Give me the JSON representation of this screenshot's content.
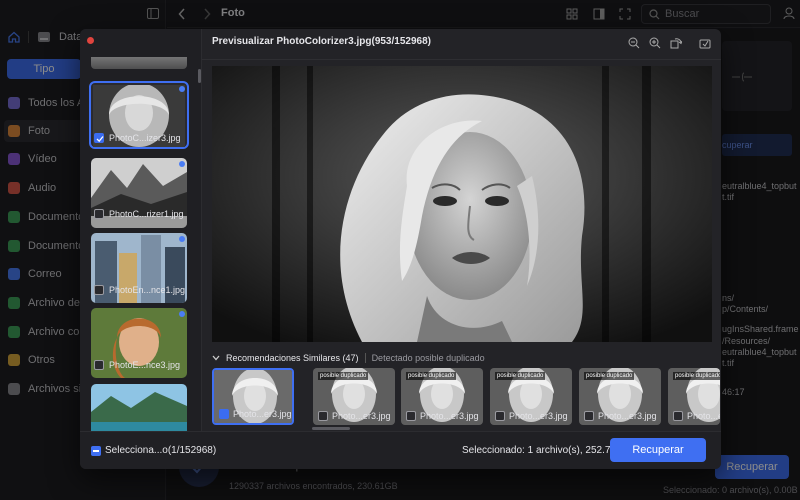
{
  "sidebar": {
    "root_label": "Data",
    "tipo_button": "Tipo",
    "items": [
      {
        "label": "Todos los Arc",
        "icon": "all-files-icon",
        "color": "#7a6fd8"
      },
      {
        "label": "Foto",
        "icon": "photo-icon",
        "color": "#e08a3c"
      },
      {
        "label": "Vídeo",
        "icon": "video-icon",
        "color": "#8a5ad8"
      },
      {
        "label": "Audio",
        "icon": "audio-icon",
        "color": "#d8584a"
      },
      {
        "label": "Documento",
        "icon": "document-icon",
        "color": "#3fa05a"
      },
      {
        "label": "Documentos",
        "icon": "documents-icon",
        "color": "#3fa05a"
      },
      {
        "label": "Correo",
        "icon": "mail-icon",
        "color": "#4a7df5"
      },
      {
        "label": "Archivo de la",
        "icon": "archive-icon",
        "color": "#3fa05a"
      },
      {
        "label": "Archivo comp",
        "icon": "compressed-icon",
        "color": "#3fa05a"
      },
      {
        "label": "Otros",
        "icon": "other-icon",
        "color": "#d8a83c"
      },
      {
        "label": "Archivos sin s",
        "icon": "unsaved-icon",
        "color": "#8a8a90"
      }
    ]
  },
  "toolbar": {
    "title": "Foto",
    "search_placeholder": "Buscar"
  },
  "background_panel": {
    "recover_link": "cuperar",
    "lines": [
      "eutralblue4_topbut",
      "t.tif",
      "ns/",
      "p/Contents/",
      "ugInsShared.frame",
      "/Resources/",
      "eutralblue4_topbut",
      "t.tif",
      "46:17"
    ],
    "recover_button": "Recuperar",
    "selected_text": "Seleccionado: 0 archivo(s), 0.00B",
    "scan_title": "Escaneo completado.",
    "scan_summary": "1290337 archivos encontrados, 230.61GB"
  },
  "modal": {
    "title": "Previsualizar PhotoColorizer3.jpg(953/152968)",
    "thumbnails": [
      {
        "label": "PhotoC...izer3.jpg",
        "checked": true
      },
      {
        "label": "PhotoC...rizer1.jpg",
        "checked": false
      },
      {
        "label": "PhotoEn...nce1.jpg",
        "checked": false
      },
      {
        "label": "PhotoE...nce3.jpg",
        "checked": false
      }
    ],
    "similar": {
      "title": "Recomendaciones Similares (47)",
      "hint": "Detectado posible duplicado",
      "items": [
        {
          "label": "Photo...er3.jpg",
          "tag": "",
          "checked": true
        },
        {
          "label": "Photo...er3.jpg",
          "tag": "posible duplicado",
          "checked": false
        },
        {
          "label": "Photo...er3.jpg",
          "tag": "posible duplicado",
          "checked": false
        },
        {
          "label": "Photo...er3.jpg",
          "tag": "posible duplicado",
          "checked": false
        },
        {
          "label": "Photo...er3.jpg",
          "tag": "posible duplicado",
          "checked": false
        },
        {
          "label": "Photo...er3.jpg",
          "tag": "posible duplicado",
          "checked": false
        }
      ]
    },
    "footer": {
      "select_label": "Selecciona...o(1/152968)",
      "selected_text": "Seleccionado: 1 archivo(s), 252.79KB",
      "recover_button": "Recuperar"
    }
  },
  "colors": {
    "accent": "#3f6ff2",
    "close_dot": "#e0443e"
  }
}
